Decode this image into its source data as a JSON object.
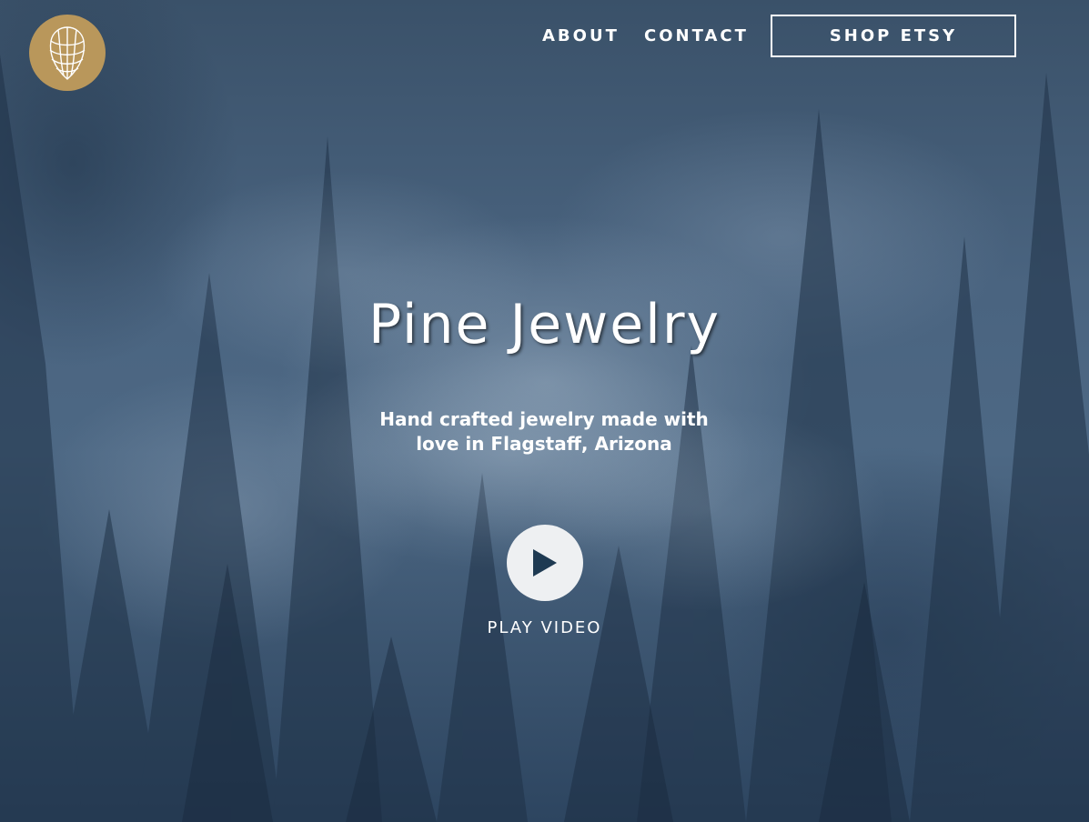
{
  "header": {
    "logo_icon": "pinecone-icon",
    "nav": [
      {
        "label": "ABOUT"
      },
      {
        "label": "CONTACT"
      }
    ],
    "shop_button": "SHOP ETSY"
  },
  "hero": {
    "title": "Pine Jewelry",
    "subtitle": "Hand crafted jewelry made with love in Flagstaff, Arizona",
    "play_icon": "play-icon",
    "play_label": "PLAY VIDEO"
  },
  "colors": {
    "brand_gold": "#b9975b",
    "text": "#ffffff",
    "play_circle": "#eef0f2",
    "play_triangle": "#1e3a52"
  }
}
